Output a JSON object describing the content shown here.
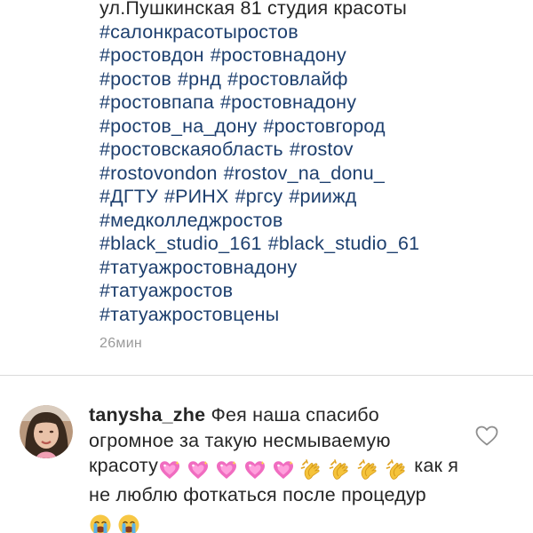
{
  "caption": {
    "address_line": "ул.Пушкинская 81 студия красоты",
    "hashtag_lines": [
      [
        "#салонкрасотыростов"
      ],
      [
        "#ростовдон",
        "#ростовнадону"
      ],
      [
        "#ростов",
        "#рнд",
        "#ростовлайф"
      ],
      [
        "#ростовпапа",
        "#ростовнадону"
      ],
      [
        "#ростов_на_дону",
        "#ростовгород"
      ],
      [
        "#ростовскаяобласть",
        "#rostov"
      ],
      [
        "#rostovondon",
        "#rostov_na_donu_"
      ],
      [
        "#ДГТУ",
        "#РИНХ",
        "#ргсу",
        "#риижд"
      ],
      [
        "#медколледжростов"
      ],
      [
        "#black_studio_161",
        "#black_studio_61"
      ],
      [
        "#татуажростовнадону"
      ],
      [
        "#татуажростов"
      ],
      [
        "#татуажростовцены"
      ]
    ]
  },
  "timestamp": "26мин",
  "comment": {
    "username": "tanysha_zhe",
    "text_part1": "Фея наша спасибо огромное за такую несмываемую красоту",
    "emoji_row1": [
      "sparkling-heart",
      "sparkling-heart",
      "sparkling-heart",
      "sparkling-heart",
      "sparkling-heart",
      "clapping-hands",
      "clapping-hands",
      "clapping-hands",
      "clapping-hands"
    ],
    "text_part2": "как я не люблю фоткаться после процедур",
    "emoji_row2": [
      "crying-face",
      "crying-face"
    ]
  },
  "icons": {
    "like": "heart-outline-icon"
  },
  "colors": {
    "hashtag": "#1d3f6e",
    "text": "#262626",
    "timestamp": "#9a9a9a",
    "divider": "#dbdbdb",
    "sparkling_heart": "#f06cc0",
    "clap": "#f5c33b",
    "crying_face": "#f7c744",
    "tear": "#5bb3e8"
  }
}
